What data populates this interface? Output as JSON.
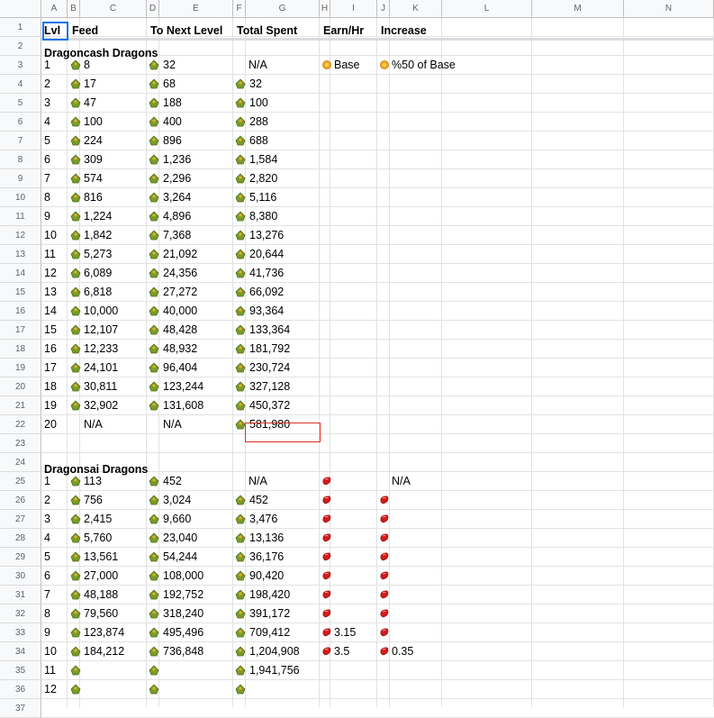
{
  "columns": [
    "A",
    "B",
    "C",
    "D",
    "E",
    "F",
    "G",
    "H",
    "I",
    "J",
    "K",
    "L",
    "M",
    "N"
  ],
  "header": {
    "lvl": "Lvl",
    "feed": "Feed",
    "next": "To Next Level",
    "total": "Total Spent",
    "earn": "Earn/Hr",
    "increase": "Increase"
  },
  "sections": [
    {
      "title": "Dragoncash Dragons"
    },
    {
      "title": "Dragonsai Dragons"
    }
  ],
  "cash_rows": [
    {
      "lvl": "1",
      "feed": "8",
      "next": "32",
      "total": "N/A",
      "earn": "Base",
      "inc": "%50 of Base"
    },
    {
      "lvl": "2",
      "feed": "17",
      "next": "68",
      "total": "32"
    },
    {
      "lvl": "3",
      "feed": "47",
      "next": "188",
      "total": "100"
    },
    {
      "lvl": "4",
      "feed": "100",
      "next": "400",
      "total": "288"
    },
    {
      "lvl": "5",
      "feed": "224",
      "next": "896",
      "total": "688"
    },
    {
      "lvl": "6",
      "feed": "309",
      "next": "1,236",
      "total": "1,584"
    },
    {
      "lvl": "7",
      "feed": "574",
      "next": "2,296",
      "total": "2,820"
    },
    {
      "lvl": "8",
      "feed": "816",
      "next": "3,264",
      "total": "5,116"
    },
    {
      "lvl": "9",
      "feed": "1,224",
      "next": "4,896",
      "total": "8,380"
    },
    {
      "lvl": "10",
      "feed": "1,842",
      "next": "7,368",
      "total": "13,276"
    },
    {
      "lvl": "11",
      "feed": "5,273",
      "next": "21,092",
      "total": "20,644"
    },
    {
      "lvl": "12",
      "feed": "6,089",
      "next": "24,356",
      "total": "41,736"
    },
    {
      "lvl": "13",
      "feed": "6,818",
      "next": "27,272",
      "total": "66,092"
    },
    {
      "lvl": "14",
      "feed": "10,000",
      "next": "40,000",
      "total": "93,364"
    },
    {
      "lvl": "15",
      "feed": "12,107",
      "next": "48,428",
      "total": "133,364"
    },
    {
      "lvl": "16",
      "feed": "12,233",
      "next": "48,932",
      "total": "181,792"
    },
    {
      "lvl": "17",
      "feed": "24,101",
      "next": "96,404",
      "total": "230,724"
    },
    {
      "lvl": "18",
      "feed": "30,811",
      "next": "123,244",
      "total": "327,128"
    },
    {
      "lvl": "19",
      "feed": "32,902",
      "next": "131,608",
      "total": "450,372"
    },
    {
      "lvl": "20",
      "feed": "N/A",
      "next": "N/A",
      "total": "581,980"
    }
  ],
  "sai_rows": [
    {
      "lvl": "1",
      "feed": "113",
      "next": "452",
      "total": "N/A",
      "earn": "",
      "inc": "N/A"
    },
    {
      "lvl": "2",
      "feed": "756",
      "next": "3,024",
      "total": "452"
    },
    {
      "lvl": "3",
      "feed": "2,415",
      "next": "9,660",
      "total": "3,476"
    },
    {
      "lvl": "4",
      "feed": "5,760",
      "next": "23,040",
      "total": "13,136"
    },
    {
      "lvl": "5",
      "feed": "13,561",
      "next": "54,244",
      "total": "36,176"
    },
    {
      "lvl": "6",
      "feed": "27,000",
      "next": "108,000",
      "total": "90,420"
    },
    {
      "lvl": "7",
      "feed": "48,188",
      "next": "192,752",
      "total": "198,420"
    },
    {
      "lvl": "8",
      "feed": "79,560",
      "next": "318,240",
      "total": "391,172"
    },
    {
      "lvl": "9",
      "feed": "123,874",
      "next": "495,496",
      "total": "709,412",
      "earn": "3.15"
    },
    {
      "lvl": "10",
      "feed": "184,212",
      "next": "736,848",
      "total": "1,204,908",
      "earn": "3.5",
      "inc": "0.35"
    },
    {
      "lvl": "11",
      "feed": "",
      "next": "",
      "total": "1,941,756"
    },
    {
      "lvl": "12",
      "feed": "",
      "next": "",
      "total": ""
    }
  ],
  "icons": {
    "feed": "food-icon",
    "coin": "coin-icon",
    "gem": "red-gem-icon"
  },
  "colors": {
    "food": "#7a9a2a",
    "coin": "#f5a623",
    "gem": "#d31a1a",
    "selection": "#1a73e8",
    "error": "#d93025"
  }
}
